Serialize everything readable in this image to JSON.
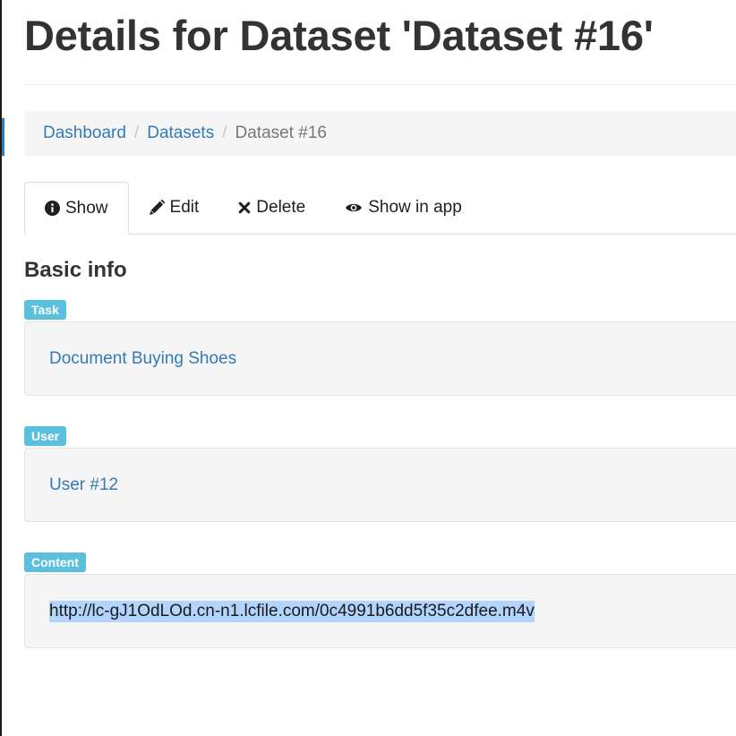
{
  "header": {
    "title": "Details for Dataset 'Dataset #16'"
  },
  "breadcrumb": {
    "items": [
      {
        "label": "Dashboard"
      },
      {
        "label": "Datasets"
      },
      {
        "label": "Dataset #16"
      }
    ],
    "separator": "/"
  },
  "tabs": [
    {
      "label": "Show",
      "icon": "info-circle-icon",
      "active": true
    },
    {
      "label": "Edit",
      "icon": "pencil-icon",
      "active": false
    },
    {
      "label": "Delete",
      "icon": "times-icon",
      "active": false
    },
    {
      "label": "Show in app",
      "icon": "eye-icon",
      "active": false
    }
  ],
  "section": {
    "title": "Basic info"
  },
  "fields": {
    "task": {
      "label": "Task",
      "value": "Document Buying Shoes"
    },
    "user": {
      "label": "User",
      "value": "User #12"
    },
    "content": {
      "label": "Content",
      "value": "http://lc-gJ1OdLOd.cn-n1.lcfile.com/0c4991b6dd5f35c2dfee.m4v"
    }
  },
  "colors": {
    "link": "#337ab7",
    "label_info": "#5bc0de",
    "selection": "#b3d4fd"
  }
}
